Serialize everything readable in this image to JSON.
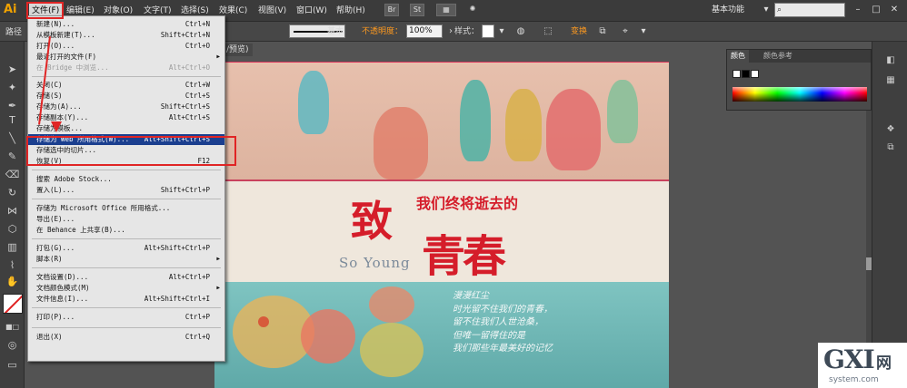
{
  "menubar": {
    "logo": "Ai",
    "items": [
      "文件(F)",
      "编辑(E)",
      "对象(O)",
      "文字(T)",
      "选择(S)",
      "效果(C)",
      "视图(V)",
      "窗口(W)",
      "帮助(H)"
    ],
    "br_label": "Br",
    "st_label": "St",
    "workspace": "基本功能",
    "search_placeholder": ""
  },
  "controlbar": {
    "path_label": "路径",
    "stroke_style": "基本",
    "opacity_label": "不透明度：",
    "opacity_value": "100%",
    "style_label": "样式：",
    "transform_label": "变换"
  },
  "document": {
    "tab_label": "/预览)"
  },
  "file_menu": {
    "items": [
      {
        "label": "新建(N)...",
        "shortcut": "Ctrl+N"
      },
      {
        "label": "从模板新建(T)...",
        "shortcut": "Shift+Ctrl+N"
      },
      {
        "label": "打开(O)...",
        "shortcut": "Ctrl+O"
      },
      {
        "label": "最近打开的文件(F)",
        "shortcut": ""
      },
      {
        "label": "在 Bridge 中浏览...",
        "shortcut": "Alt+Ctrl+O"
      },
      {
        "label": "关闭(C)",
        "shortcut": "Ctrl+W"
      },
      {
        "label": "存储(S)",
        "shortcut": "Ctrl+S"
      },
      {
        "label": "存储为(A)...",
        "shortcut": "Shift+Ctrl+S"
      },
      {
        "label": "存储副本(Y)...",
        "shortcut": "Alt+Ctrl+S"
      },
      {
        "label": "存储为模板...",
        "shortcut": ""
      },
      {
        "label": "存储为 Web 所用格式(W)...",
        "shortcut": "Alt+Shift+Ctrl+S"
      },
      {
        "label": "存储选中的切片...",
        "shortcut": ""
      },
      {
        "label": "恢复(V)",
        "shortcut": "F12"
      },
      {
        "label": "搜索 Adobe Stock...",
        "shortcut": ""
      },
      {
        "label": "置入(L)...",
        "shortcut": "Shift+Ctrl+P"
      },
      {
        "label": "存储为 Microsoft Office 所用格式...",
        "shortcut": ""
      },
      {
        "label": "导出(E)...",
        "shortcut": ""
      },
      {
        "label": "在 Behance 上共享(B)...",
        "shortcut": ""
      },
      {
        "label": "打包(G)...",
        "shortcut": "Alt+Shift+Ctrl+P"
      },
      {
        "label": "脚本(R)",
        "shortcut": ""
      },
      {
        "label": "文档设置(D)...",
        "shortcut": "Alt+Ctrl+P"
      },
      {
        "label": "文档颜色模式(M)",
        "shortcut": ""
      },
      {
        "label": "文件信息(I)...",
        "shortcut": "Alt+Shift+Ctrl+I"
      },
      {
        "label": "打印(P)...",
        "shortcut": "Ctrl+P"
      },
      {
        "label": "退出(X)",
        "shortcut": "Ctrl+Q"
      }
    ]
  },
  "artwork": {
    "title_big": "致",
    "title_big2": "青春",
    "subtitle": "我们终将逝去的",
    "english": "So Young",
    "poem": [
      "漫漫红尘",
      "时光留不住我们的青春，",
      "留不住我们人世沧桑，",
      "但唯一留得住的是",
      "我们那些年最美好的记忆"
    ]
  },
  "color_panel": {
    "tab_color": "颜色",
    "tab_guide": "颜色参考"
  },
  "watermark": {
    "main": "GXI",
    "cn": "网",
    "domain": "system.com"
  },
  "colors": {
    "accent_red": "#e02525",
    "highlight_blue": "#1b3f8f",
    "title_red": "#d51d2a"
  }
}
